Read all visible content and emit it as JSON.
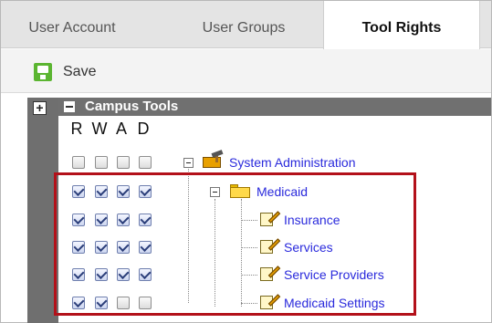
{
  "tabs": [
    {
      "label": "User Account"
    },
    {
      "label": "User Groups"
    },
    {
      "label": "Tool Rights"
    }
  ],
  "toolbar": {
    "save_label": "Save"
  },
  "tree": {
    "expand_symbol": "+",
    "header": "Campus Tools",
    "columns": [
      "R",
      "W",
      "A",
      "D"
    ],
    "nodes": [
      {
        "label": "System Administration",
        "icon": "toolbox-icon",
        "rights": [
          false,
          false,
          false,
          false
        ]
      },
      {
        "label": "Medicaid",
        "icon": "folder-icon",
        "rights": [
          true,
          true,
          true,
          true
        ]
      },
      {
        "label": "Insurance",
        "icon": "note-pencil-icon",
        "rights": [
          true,
          true,
          true,
          true
        ]
      },
      {
        "label": "Services",
        "icon": "note-pencil-icon",
        "rights": [
          true,
          true,
          true,
          true
        ]
      },
      {
        "label": "Service Providers",
        "icon": "note-pencil-icon",
        "rights": [
          true,
          true,
          true,
          true
        ]
      },
      {
        "label": "Medicaid Settings",
        "icon": "note-pencil-icon",
        "rights": [
          true,
          true,
          false,
          false
        ]
      }
    ]
  },
  "colors": {
    "highlight": "#b3111a",
    "link": "#2a2adc",
    "save": "#5bb531"
  }
}
